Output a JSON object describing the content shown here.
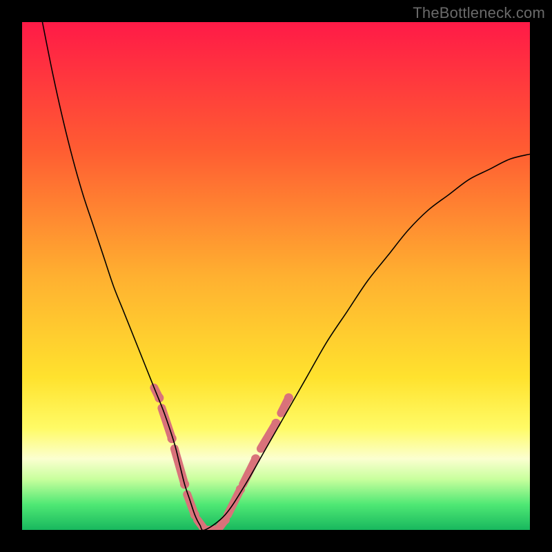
{
  "watermark": "TheBottleneck.com",
  "chart_data": {
    "type": "line",
    "title": "",
    "xlabel": "",
    "ylabel": "",
    "xlim": [
      0,
      100
    ],
    "ylim": [
      0,
      100
    ],
    "grid": false,
    "legend": false,
    "background_gradient": {
      "stops": [
        {
          "offset": 0,
          "color": "#ff1a47"
        },
        {
          "offset": 25,
          "color": "#ff5c32"
        },
        {
          "offset": 50,
          "color": "#ffb030"
        },
        {
          "offset": 70,
          "color": "#ffe22e"
        },
        {
          "offset": 80,
          "color": "#fffb66"
        },
        {
          "offset": 86,
          "color": "#fbffd0"
        },
        {
          "offset": 90,
          "color": "#c8ff9d"
        },
        {
          "offset": 95,
          "color": "#4fe874"
        },
        {
          "offset": 100,
          "color": "#18b85e"
        }
      ]
    },
    "series": [
      {
        "name": "curve",
        "color": "#000000",
        "x": [
          4,
          6,
          8,
          10,
          12,
          14,
          16,
          18,
          20,
          22,
          24,
          26,
          28,
          30,
          31,
          32,
          33,
          34,
          35,
          36,
          40,
          44,
          48,
          52,
          56,
          60,
          64,
          68,
          72,
          76,
          80,
          84,
          88,
          92,
          96,
          100
        ],
        "y": [
          100,
          90,
          81,
          73,
          66,
          60,
          54,
          48,
          43,
          38,
          33,
          28,
          23,
          17,
          13,
          9,
          6,
          3,
          1,
          0,
          3,
          9,
          16,
          23,
          30,
          37,
          43,
          49,
          54,
          59,
          63,
          66,
          69,
          71,
          73,
          74
        ]
      }
    ],
    "speckle_segments": [
      {
        "x0": 26,
        "y0": 28,
        "x1": 27,
        "y1": 26
      },
      {
        "x0": 27.5,
        "y0": 24,
        "x1": 29.5,
        "y1": 18
      },
      {
        "x0": 30,
        "y0": 16,
        "x1": 32,
        "y1": 9
      },
      {
        "x0": 32.5,
        "y0": 7,
        "x1": 34,
        "y1": 3
      },
      {
        "x0": 34.5,
        "y0": 2,
        "x1": 36,
        "y1": 0
      },
      {
        "x0": 36.5,
        "y0": 0,
        "x1": 38,
        "y1": 0
      },
      {
        "x0": 38.5,
        "y0": 0,
        "x1": 40,
        "y1": 2
      },
      {
        "x0": 40.5,
        "y0": 3,
        "x1": 43,
        "y1": 8
      },
      {
        "x0": 43.5,
        "y0": 9,
        "x1": 46,
        "y1": 14
      },
      {
        "x0": 47,
        "y0": 16,
        "x1": 50,
        "y1": 21
      },
      {
        "x0": 51,
        "y0": 23,
        "x1": 52.5,
        "y1": 26
      }
    ],
    "speckle_color": "#d9727a",
    "speckle_width": 2.5
  }
}
